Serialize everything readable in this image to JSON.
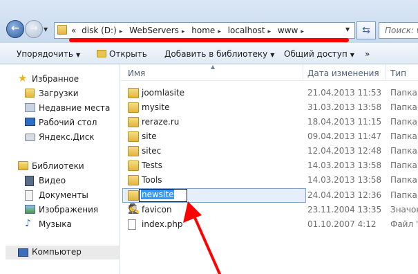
{
  "address": {
    "crumbs": [
      "disk (D:)",
      "WebServers",
      "home",
      "localhost",
      "www"
    ],
    "prefix": "«",
    "separator": "▸"
  },
  "search": {
    "placeholder": "Поиск: www"
  },
  "toolbar": {
    "organize": "Упорядочить",
    "open": "Открыть",
    "add_library": "Добавить в библиотеку",
    "share": "Общий доступ",
    "more": "»"
  },
  "nav": {
    "favorites": "Избранное",
    "downloads": "Загрузки",
    "recent": "Недавние места",
    "desktop": "Рабочий стол",
    "yandex": "Яндекс.Диск",
    "libraries": "Библиотеки",
    "video": "Видео",
    "documents": "Документы",
    "images": "Изображения",
    "music": "Музыка",
    "computer": "Компьютер"
  },
  "columns": {
    "name": "Имя",
    "date": "Дата изменения",
    "type": "Тип"
  },
  "files": [
    {
      "name": "joomlasite",
      "date": "21.04.2013 11:53",
      "type": "Папка с",
      "icon": "folder"
    },
    {
      "name": "mysite",
      "date": "31.03.2013 13:58",
      "type": "Папка с",
      "icon": "folder"
    },
    {
      "name": "reraze.ru",
      "date": "18.04.2013 11:15",
      "type": "Папка с",
      "icon": "folder"
    },
    {
      "name": "site",
      "date": "09.04.2013 11:47",
      "type": "Папка с",
      "icon": "folder"
    },
    {
      "name": "sitec",
      "date": "12.04.2013 12:48",
      "type": "Папка с",
      "icon": "folder"
    },
    {
      "name": "Tests",
      "date": "14.03.2013 13:58",
      "type": "Папка с",
      "icon": "folder"
    },
    {
      "name": "Tools",
      "date": "14.03.2013 13:58",
      "type": "Папка с",
      "icon": "folder"
    },
    {
      "name": "newsite",
      "date": "24.04.2013 12:36",
      "type": "Папка с",
      "icon": "folder"
    },
    {
      "name": "favicon",
      "date": "23.11.2004 13:35",
      "type": "Значок",
      "icon": "favicon"
    },
    {
      "name": "index.php",
      "date": "01.10.2007 4:12",
      "type": "Файл \"P",
      "icon": "file"
    }
  ],
  "rename_value": "newsite"
}
